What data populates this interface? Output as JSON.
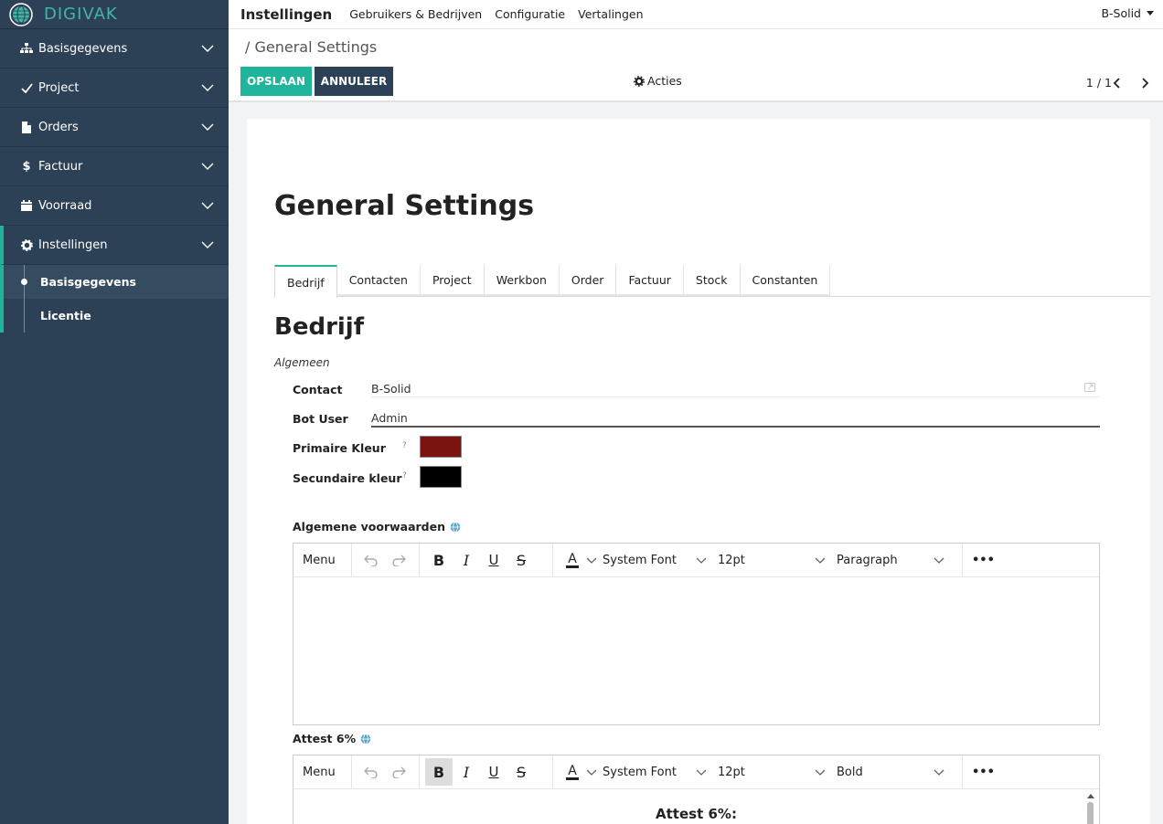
{
  "brand": {
    "name": "DIGIVAK",
    "color": "#41b6a8"
  },
  "sidebar": {
    "items": [
      {
        "label": "Basisgegevens",
        "icon": "sitemap-icon"
      },
      {
        "label": "Project",
        "icon": "check-icon"
      },
      {
        "label": "Orders",
        "icon": "file-icon"
      },
      {
        "label": "Factuur",
        "icon": "dollar-icon"
      },
      {
        "label": "Voorraad",
        "icon": "calendar-icon"
      },
      {
        "label": "Instellingen",
        "icon": "gear-icon",
        "active": true
      }
    ],
    "subitems": [
      {
        "label": "Basisgegevens",
        "active": true
      },
      {
        "label": "Licentie"
      }
    ]
  },
  "topbar": {
    "app_title": "Instellingen",
    "menu": [
      "Gebruikers & Bedrijven",
      "Configuratie",
      "Vertalingen"
    ],
    "user": "B-Solid"
  },
  "control": {
    "breadcrumb": "/ General Settings",
    "save_label": "OPSLAAN",
    "cancel_label": "ANNULEER",
    "actions_label": "Acties",
    "pager": "1 / 1"
  },
  "form": {
    "title": "General Settings",
    "tabs": [
      "Bedrijf",
      "Contacten",
      "Project",
      "Werkbon",
      "Order",
      "Factuur",
      "Stock",
      "Constanten"
    ],
    "active_tab": "Bedrijf",
    "section_title": "Bedrijf",
    "group_label": "Algemeen",
    "fields": {
      "contact": {
        "label": "Contact",
        "value": "B-Solid"
      },
      "bot_user": {
        "label": "Bot User",
        "value": "Admin"
      },
      "primary_color": {
        "label": "Primaire Kleur",
        "help": "?",
        "value": "#7a1410"
      },
      "secondary_color": {
        "label": "Secundaire kleur",
        "help": "?",
        "value": "#000000"
      }
    },
    "editors": [
      {
        "label": "Algemene voorwaarden",
        "toolbar": {
          "menu": "Menu",
          "bold": "B",
          "italic": "I",
          "underline": "U",
          "strike": "S",
          "font_color": "A",
          "font": "System Font",
          "size": "12pt",
          "block": "Paragraph",
          "more": "•••"
        },
        "content": ""
      },
      {
        "label": "Attest 6%",
        "toolbar": {
          "menu": "Menu",
          "bold": "B",
          "italic": "I",
          "underline": "U",
          "strike": "S",
          "font_color": "A",
          "font": "System Font",
          "size": "12pt",
          "block": "Bold",
          "more": "•••"
        },
        "content": "Attest 6%:"
      }
    ]
  },
  "colors": {
    "accent": "#1fb59a",
    "sidebar_bg": "#2c4155"
  }
}
